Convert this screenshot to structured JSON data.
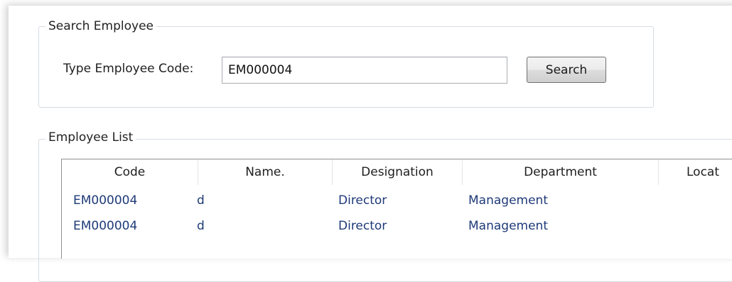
{
  "search_group": {
    "title": "Search Employee",
    "field_label": "Type Employee Code:",
    "code_value": "EM000004",
    "search_button_label": "Search"
  },
  "list_group": {
    "title": "Employee List",
    "columns": [
      "Code",
      "Name.",
      "Designation",
      "Department",
      "Locat"
    ],
    "rows": [
      {
        "code": "EM000004",
        "name": "d",
        "designation": "Director",
        "department": "Management"
      },
      {
        "code": "EM000004",
        "name": "d",
        "designation": "Director",
        "department": "Management"
      }
    ]
  },
  "colors": {
    "cell_text": "#1e3a78",
    "groupbox_border": "#d5dbe1",
    "grid_border": "#8e8f8f"
  }
}
